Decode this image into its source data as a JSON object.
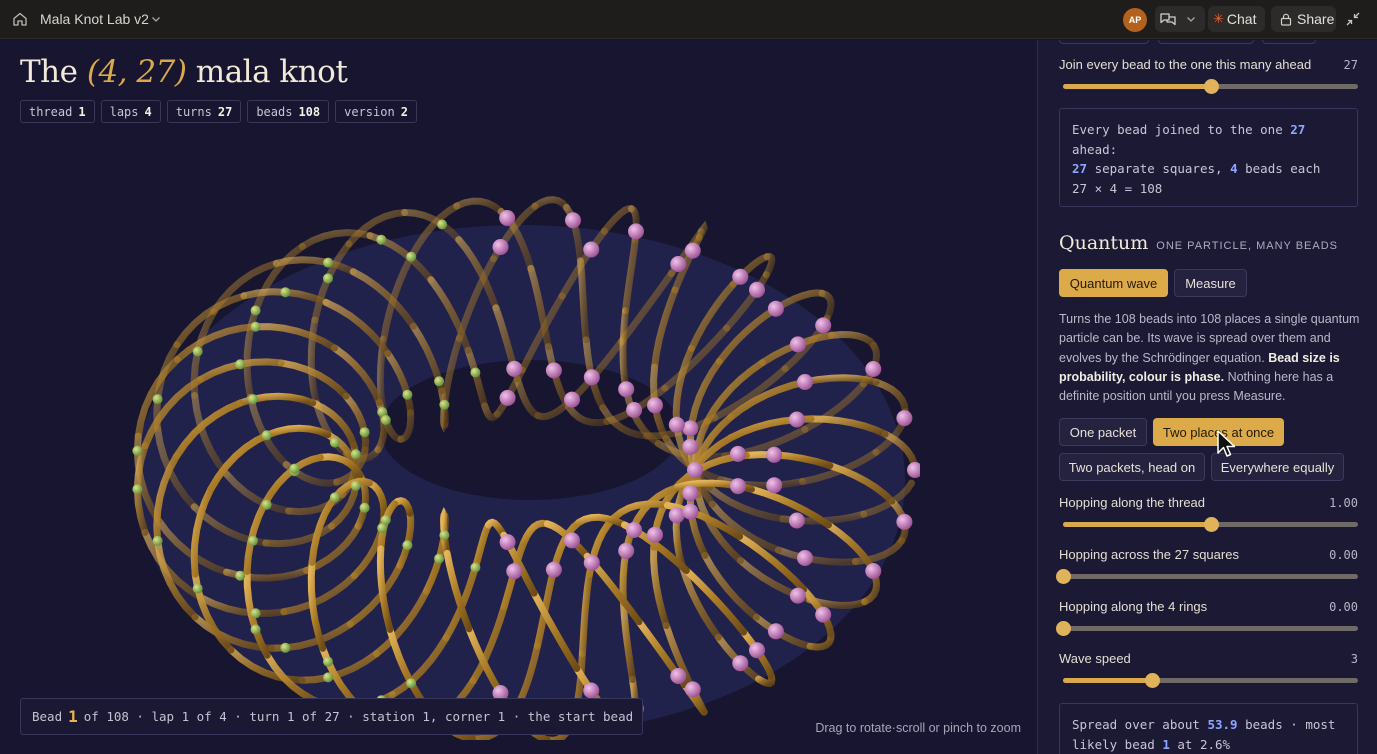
{
  "topbar": {
    "title": "Mala Knot Lab v2",
    "avatar_initials": "AP",
    "chat_label": "Chat",
    "share_label": "Share",
    "icons": [
      "home-icon",
      "chevron-down-icon",
      "chats-icon",
      "lock-icon",
      "collapse-icon"
    ]
  },
  "main": {
    "heading_prefix": "The",
    "heading_accent": "(4, 27)",
    "heading_suffix": "mala knot",
    "chips": [
      {
        "label": "thread",
        "value": "1"
      },
      {
        "label": "laps",
        "value": "4"
      },
      {
        "label": "turns",
        "value": "27"
      },
      {
        "label": "beads",
        "value": "108"
      },
      {
        "label": "version",
        "value": "2"
      }
    ],
    "status": {
      "prefix": "Bead",
      "bead": "1",
      "rest": "of 108 · lap 1 of 4 · turn 1 of 27 · station 1, corner 1 · the start bead"
    },
    "hint": "Drag to rotate·scroll or pinch to zoom"
  },
  "panel": {
    "join_slider": {
      "label": "Join every bead to the one this many ahead",
      "value": "27",
      "fraction": 0.5
    },
    "join_box": {
      "line1_prefix": "Every bead joined to the one",
      "line1_value": "27",
      "line2": "ahead:",
      "line3_a": "27",
      "line3_b": "separate squares,",
      "line3_c": "4",
      "line3_d": "beads each",
      "line4": "27 × 4 = 108"
    },
    "quantum": {
      "title": "Quantum",
      "subtitle": "ONE PARTICLE, MANY BEADS",
      "wave_button": "Quantum wave",
      "measure_button": "Measure",
      "desc_1": "Turns the 108 beads into 108 places a single quantum particle can be. Its wave is spread over them and evolves by the Schrödinger equation.",
      "desc_bold": "Bead size is probability, colour is phase.",
      "desc_2": "Nothing here has a definite position until you press Measure.",
      "presets": [
        "One packet",
        "Two places at once",
        "Two packets, head on",
        "Everywhere equally"
      ]
    },
    "sliders": [
      {
        "label": "Hopping along the thread",
        "value": "1.00",
        "fraction": 0.5
      },
      {
        "label": "Hopping across the 27 squares",
        "value": "0.00",
        "fraction": 0.0
      },
      {
        "label": "Hopping along the 4 rings",
        "value": "0.00",
        "fraction": 0.0
      },
      {
        "label": "Wave speed",
        "value": "3",
        "fraction": 0.3
      }
    ],
    "spread_box": {
      "a": "Spread over about",
      "b": "53.9",
      "c": "beads · most",
      "d": "likely bead",
      "e": "1",
      "f": "at 2.6%"
    }
  },
  "colors": {
    "accent": "#d9a94a",
    "background": "#17152f",
    "panel": "#1b1934",
    "topbar": "#1e1d1c"
  }
}
